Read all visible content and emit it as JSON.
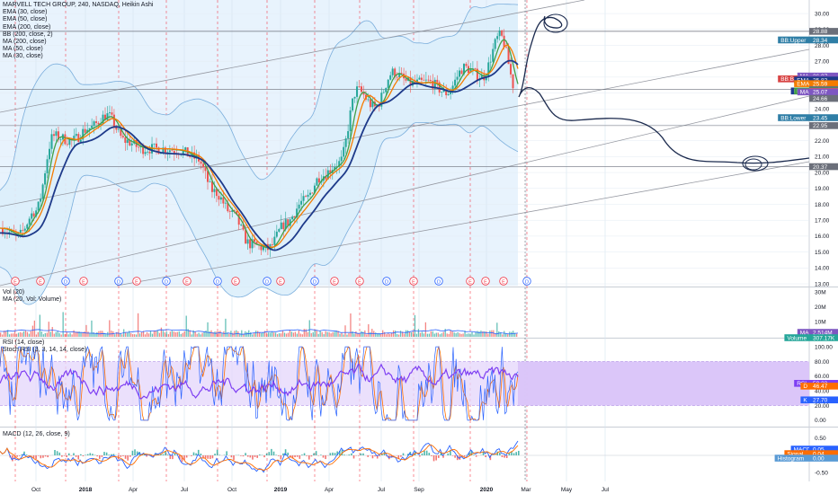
{
  "colors": {
    "up": "#26a69a",
    "down": "#ef5350",
    "ema50": "#f57c00",
    "ema30": "#43a047",
    "ema200": "#1e3a8a",
    "bb": "#7baedc",
    "bbfill": "#dbeefb",
    "rsi": "#7e3ff2",
    "stochK": "#2962ff",
    "stochD": "#ff6d00",
    "macd": "#2962ff",
    "signal": "#ff6d00",
    "ink": "#1b2a4e",
    "trend": "#9598a1",
    "earn": "#f23645",
    "div": "#2962ff"
  },
  "legend_main": [
    "MARVELL TECH GROUP, 240, NASDAQ, Heikin Ashi",
    "EMA (30, close)",
    "EMA (50, close)",
    "EMA (200, close)",
    "BB (200, close, 2)",
    "MA (200, close)",
    "MA (50, close)",
    "MA (30, close)"
  ],
  "legend_vol": [
    "Vol (20)",
    "MA (20, Vol: Volume)"
  ],
  "legend_rsi": [
    "RSI (14, close)",
    "Stoch RSI (3, 3, 14, 14, close)"
  ],
  "legend_macd": [
    "MACD (12, 26, close, 9)"
  ],
  "chart_data": [
    {
      "type": "candlestick",
      "title": "MARVELL TECH GROUP, 240, NASDAQ, Heikin Ashi",
      "ylim": [
        13,
        30.4
      ],
      "yticks": [
        "30.00",
        "29.00",
        "28.00",
        "27.00",
        "26.00",
        "25.00",
        "24.00",
        "23.00",
        "22.00",
        "21.00",
        "20.00",
        "19.00",
        "18.00",
        "17.00",
        "16.00",
        "15.00",
        "14.00",
        "13.00"
      ],
      "x": [
        "Oct",
        "2018",
        "Apr",
        "Jul",
        "Oct",
        "2019",
        "Apr",
        "Jul",
        "Sep",
        "2020",
        "Mar",
        "May",
        "Jul"
      ],
      "price_path_dates": [
        "2017-09",
        "2017-10",
        "2017-11",
        "2017-12",
        "2018-01",
        "2018-02",
        "2018-03",
        "2018-04",
        "2018-05",
        "2018-06",
        "2018-07",
        "2018-08",
        "2018-09",
        "2018-10",
        "2018-11",
        "2018-12",
        "2019-01",
        "2019-02",
        "2019-03",
        "2019-04",
        "2019-05",
        "2019-06",
        "2019-07",
        "2019-08",
        "2019-09",
        "2019-10",
        "2019-11",
        "2019-12",
        "2020-01",
        "2020-02"
      ],
      "price_path": [
        16.5,
        16.0,
        17.6,
        22.3,
        22.0,
        22.8,
        23.6,
        22.0,
        21.5,
        21.5,
        21.4,
        20.9,
        18.8,
        17.4,
        15.5,
        15.2,
        16.8,
        18.2,
        19.8,
        20.6,
        25.2,
        24.1,
        26.3,
        25.6,
        25.7,
        25.0,
        26.6,
        26.0,
        28.6,
        24.8
      ],
      "series": [
        {
          "name": "EMA (30, close)"
        },
        {
          "name": "EMA (50, close)"
        },
        {
          "name": "EMA (200, close)"
        },
        {
          "name": "BB (200, close, 2)"
        }
      ],
      "price_labels": [
        {
          "label": "BB:Upper",
          "value": "28.34"
        },
        {
          "label": "MA",
          "value": "26.07"
        },
        {
          "label": "BB:Basis",
          "value": "25.89"
        },
        {
          "label": "MA",
          "value": "25.89"
        },
        {
          "label": "EMA",
          "value": "25.82"
        },
        {
          "label": "EMA",
          "value": "25.59"
        },
        {
          "label": "",
          "value": "25.22"
        },
        {
          "label": "MRVL",
          "value": "25.13"
        },
        {
          "label": "EMA",
          "value": "25.13"
        },
        {
          "label": "",
          "value": "25.10"
        },
        {
          "label": "MA",
          "value": "25.07"
        },
        {
          "label": "",
          "value": "24.66"
        },
        {
          "label": "BB:Lower",
          "value": "23.45"
        },
        {
          "label": "",
          "value": "22.95"
        }
      ],
      "level_labels": [
        "28.88",
        "20.37"
      ],
      "earnings_marks": [
        "E",
        "E",
        "D",
        "E",
        "D",
        "E",
        "D",
        "E",
        "D",
        "E",
        "D",
        "E",
        "D",
        "E",
        "E",
        "D",
        "E",
        "D",
        "E",
        "E",
        "D",
        "E"
      ],
      "annotations": [
        "projected path",
        "circles"
      ]
    },
    {
      "type": "bar",
      "title": "Vol (20)",
      "yticks": [
        "30M",
        "20M",
        "10M"
      ],
      "labels": [
        {
          "label": "MA",
          "value": "2.514M"
        },
        {
          "label": "Volume",
          "value": "307.17K"
        }
      ]
    },
    {
      "type": "line",
      "title": "RSI (14, close)",
      "yticks": [
        "100.00",
        "80.00",
        "60.00",
        "40.00",
        "20.00",
        "0.00"
      ],
      "band": [
        20,
        80
      ],
      "labels": [
        {
          "label": "RSI",
          "value": "50.23"
        },
        {
          "label": "D",
          "value": "46.47"
        },
        {
          "label": "K",
          "value": "27.70"
        }
      ]
    },
    {
      "type": "line",
      "title": "MACD (12, 26, close, 9)",
      "yticks": [
        "0.50",
        "0.00",
        "-0.50"
      ],
      "labels": [
        {
          "label": "MACD",
          "value": "0.05"
        },
        {
          "label": "Signal",
          "value": "0.04"
        },
        {
          "label": "Histogram",
          "value": "0.00"
        }
      ]
    }
  ]
}
